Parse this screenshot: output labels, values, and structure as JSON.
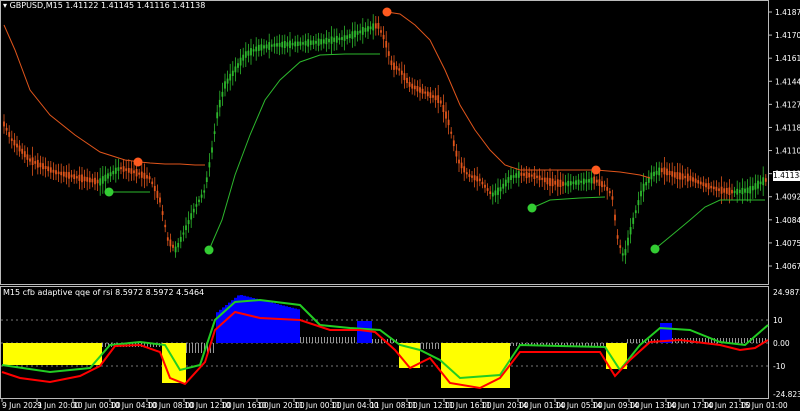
{
  "header": {
    "symbol_label": "GBPUSD,M15",
    "ohlc": "1.41122 1.41145 1.41116 1.41138"
  },
  "indicator": {
    "label": "M15  cfb adaptive qqe of rsi 8.5972 8.5972 4.5464"
  },
  "current_price": "1.41138",
  "price_axis": [
    "1.41875",
    "1.41700",
    "1.41615",
    "1.41445",
    "1.41270",
    "1.41185",
    "1.41100",
    "1.41010",
    "1.40925",
    "1.40840",
    "1.40755",
    "1.40670"
  ],
  "indicator_axis": [
    "24.9872",
    "10",
    "0.00",
    "-10",
    "-24.8236"
  ],
  "time_axis": [
    "9 Jun 2021",
    "9 Jun 20:00",
    "10 Jun 00:00",
    "10 Jun 04:00",
    "10 Jun 08:00",
    "10 Jun 12:00",
    "10 Jun 16:00",
    "10 Jun 20:00",
    "11 Jun 00:00",
    "11 Jun 04:00",
    "11 Jun 08:00",
    "11 Jun 12:00",
    "11 Jun 16:00",
    "11 Jun 20:00",
    "14 Jun 01:00",
    "14 Jun 05:00",
    "14 Jun 09:00",
    "14 Jun 13:00",
    "14 Jun 17:00",
    "14 Jun 21:00",
    "15 Jun 01:00"
  ],
  "colors": {
    "bull": "#2db82d",
    "bear": "#e0551b",
    "trail_up": "#2db82d",
    "trail_down": "#e0551b",
    "dot_up": "#33cc33",
    "dot_down": "#ff5a1f",
    "hist_pos": "#0000ff",
    "hist_neg": "#ffff00",
    "qqe_fast": "#ff0000",
    "qqe_slow_up": "#22cc22",
    "qqe_slow_down": "#999999"
  }
}
